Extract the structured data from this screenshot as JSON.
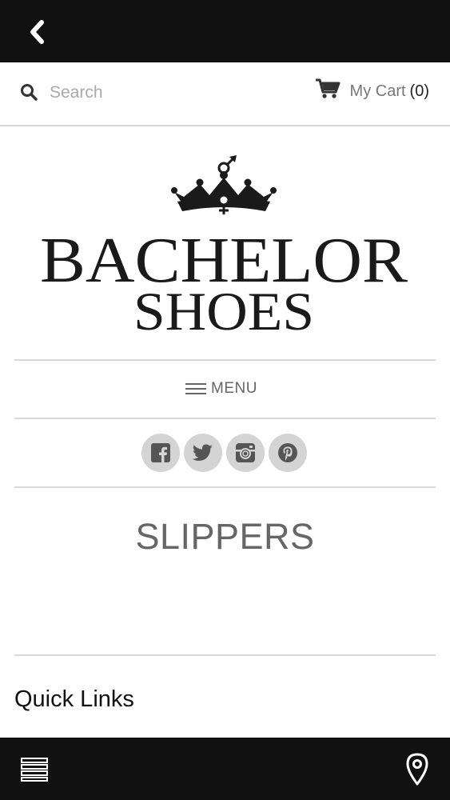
{
  "search": {
    "placeholder": "Search"
  },
  "cart": {
    "label": "My Cart",
    "count": "(0)"
  },
  "logo": {
    "line1": "BACHELOR",
    "line2": "SHOES"
  },
  "menu": {
    "label": "MENU"
  },
  "social": [
    "facebook-icon",
    "twitter-icon",
    "instagram-icon",
    "pinterest-icon"
  ],
  "page": {
    "title": "SLIPPERS"
  },
  "footer": {
    "quick_links": "Quick Links"
  },
  "colors": {
    "bar": "#111111",
    "social_circle": "#d4d4d4",
    "social_glyph": "#555555",
    "title": "#666666"
  }
}
